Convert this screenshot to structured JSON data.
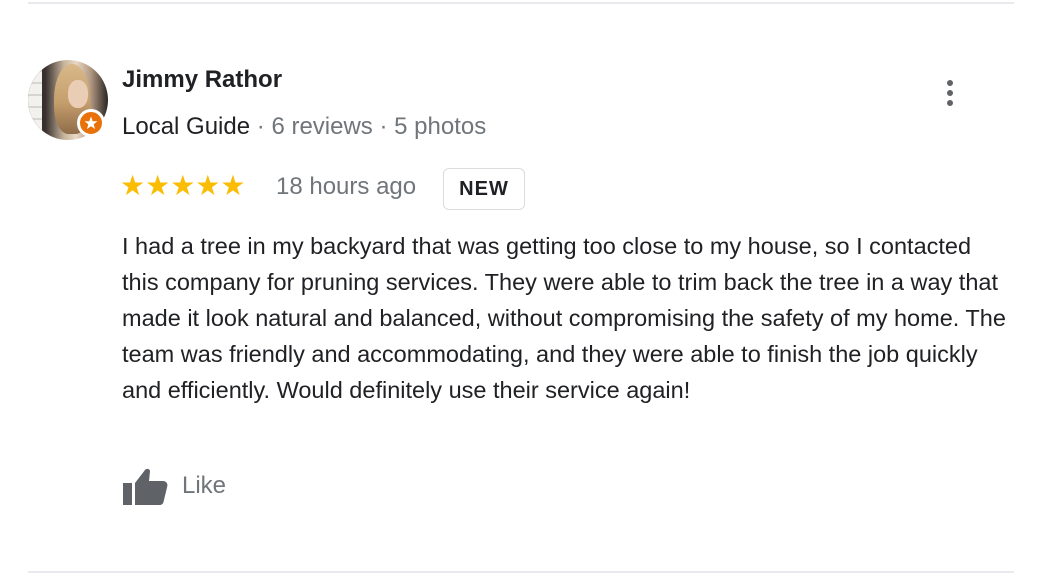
{
  "reviewer": {
    "name": "Jimmy Rathor",
    "badge": "Local Guide",
    "separator": "·",
    "reviews": "6 reviews",
    "photos": "5 photos"
  },
  "review": {
    "stars_display": "★★★★★",
    "rating": 5,
    "rating_max": 5,
    "time": "18 hours ago",
    "new_badge": "NEW",
    "text": "I had a tree in my backyard that was getting too close to my house, so I contacted this company for pruning services. They were able to trim back the tree in a way that made it look natural and balanced, without compromising the safety of my home. The team was friendly and accommodating, and they were able to finish the job quickly and efficiently. Would definitely use their service again!"
  },
  "actions": {
    "like_label": "Like",
    "like_icon": "thumbs-up-icon",
    "more_icon": "more-vert-icon"
  },
  "colors": {
    "star": "#fbbc04",
    "guide_badge": "#e8710a",
    "secondary_text": "#70757a",
    "primary_text": "#202124",
    "icon_gray": "#5f6368",
    "divider": "#e8eaed"
  }
}
